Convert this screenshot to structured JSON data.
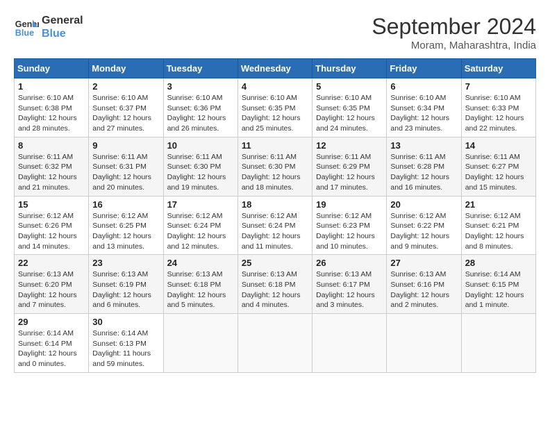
{
  "logo": {
    "line1": "General",
    "line2": "Blue"
  },
  "title": "September 2024",
  "location": "Moram, Maharashtra, India",
  "weekdays": [
    "Sunday",
    "Monday",
    "Tuesday",
    "Wednesday",
    "Thursday",
    "Friday",
    "Saturday"
  ],
  "weeks": [
    [
      {
        "day": "1",
        "info": "Sunrise: 6:10 AM\nSunset: 6:38 PM\nDaylight: 12 hours\nand 28 minutes."
      },
      {
        "day": "2",
        "info": "Sunrise: 6:10 AM\nSunset: 6:37 PM\nDaylight: 12 hours\nand 27 minutes."
      },
      {
        "day": "3",
        "info": "Sunrise: 6:10 AM\nSunset: 6:36 PM\nDaylight: 12 hours\nand 26 minutes."
      },
      {
        "day": "4",
        "info": "Sunrise: 6:10 AM\nSunset: 6:35 PM\nDaylight: 12 hours\nand 25 minutes."
      },
      {
        "day": "5",
        "info": "Sunrise: 6:10 AM\nSunset: 6:35 PM\nDaylight: 12 hours\nand 24 minutes."
      },
      {
        "day": "6",
        "info": "Sunrise: 6:10 AM\nSunset: 6:34 PM\nDaylight: 12 hours\nand 23 minutes."
      },
      {
        "day": "7",
        "info": "Sunrise: 6:10 AM\nSunset: 6:33 PM\nDaylight: 12 hours\nand 22 minutes."
      }
    ],
    [
      {
        "day": "8",
        "info": "Sunrise: 6:11 AM\nSunset: 6:32 PM\nDaylight: 12 hours\nand 21 minutes."
      },
      {
        "day": "9",
        "info": "Sunrise: 6:11 AM\nSunset: 6:31 PM\nDaylight: 12 hours\nand 20 minutes."
      },
      {
        "day": "10",
        "info": "Sunrise: 6:11 AM\nSunset: 6:30 PM\nDaylight: 12 hours\nand 19 minutes."
      },
      {
        "day": "11",
        "info": "Sunrise: 6:11 AM\nSunset: 6:30 PM\nDaylight: 12 hours\nand 18 minutes."
      },
      {
        "day": "12",
        "info": "Sunrise: 6:11 AM\nSunset: 6:29 PM\nDaylight: 12 hours\nand 17 minutes."
      },
      {
        "day": "13",
        "info": "Sunrise: 6:11 AM\nSunset: 6:28 PM\nDaylight: 12 hours\nand 16 minutes."
      },
      {
        "day": "14",
        "info": "Sunrise: 6:11 AM\nSunset: 6:27 PM\nDaylight: 12 hours\nand 15 minutes."
      }
    ],
    [
      {
        "day": "15",
        "info": "Sunrise: 6:12 AM\nSunset: 6:26 PM\nDaylight: 12 hours\nand 14 minutes."
      },
      {
        "day": "16",
        "info": "Sunrise: 6:12 AM\nSunset: 6:25 PM\nDaylight: 12 hours\nand 13 minutes."
      },
      {
        "day": "17",
        "info": "Sunrise: 6:12 AM\nSunset: 6:24 PM\nDaylight: 12 hours\nand 12 minutes."
      },
      {
        "day": "18",
        "info": "Sunrise: 6:12 AM\nSunset: 6:24 PM\nDaylight: 12 hours\nand 11 minutes."
      },
      {
        "day": "19",
        "info": "Sunrise: 6:12 AM\nSunset: 6:23 PM\nDaylight: 12 hours\nand 10 minutes."
      },
      {
        "day": "20",
        "info": "Sunrise: 6:12 AM\nSunset: 6:22 PM\nDaylight: 12 hours\nand 9 minutes."
      },
      {
        "day": "21",
        "info": "Sunrise: 6:12 AM\nSunset: 6:21 PM\nDaylight: 12 hours\nand 8 minutes."
      }
    ],
    [
      {
        "day": "22",
        "info": "Sunrise: 6:13 AM\nSunset: 6:20 PM\nDaylight: 12 hours\nand 7 minutes."
      },
      {
        "day": "23",
        "info": "Sunrise: 6:13 AM\nSunset: 6:19 PM\nDaylight: 12 hours\nand 6 minutes."
      },
      {
        "day": "24",
        "info": "Sunrise: 6:13 AM\nSunset: 6:18 PM\nDaylight: 12 hours\nand 5 minutes."
      },
      {
        "day": "25",
        "info": "Sunrise: 6:13 AM\nSunset: 6:18 PM\nDaylight: 12 hours\nand 4 minutes."
      },
      {
        "day": "26",
        "info": "Sunrise: 6:13 AM\nSunset: 6:17 PM\nDaylight: 12 hours\nand 3 minutes."
      },
      {
        "day": "27",
        "info": "Sunrise: 6:13 AM\nSunset: 6:16 PM\nDaylight: 12 hours\nand 2 minutes."
      },
      {
        "day": "28",
        "info": "Sunrise: 6:14 AM\nSunset: 6:15 PM\nDaylight: 12 hours\nand 1 minute."
      }
    ],
    [
      {
        "day": "29",
        "info": "Sunrise: 6:14 AM\nSunset: 6:14 PM\nDaylight: 12 hours\nand 0 minutes."
      },
      {
        "day": "30",
        "info": "Sunrise: 6:14 AM\nSunset: 6:13 PM\nDaylight: 11 hours\nand 59 minutes."
      },
      {
        "day": "",
        "info": ""
      },
      {
        "day": "",
        "info": ""
      },
      {
        "day": "",
        "info": ""
      },
      {
        "day": "",
        "info": ""
      },
      {
        "day": "",
        "info": ""
      }
    ]
  ]
}
